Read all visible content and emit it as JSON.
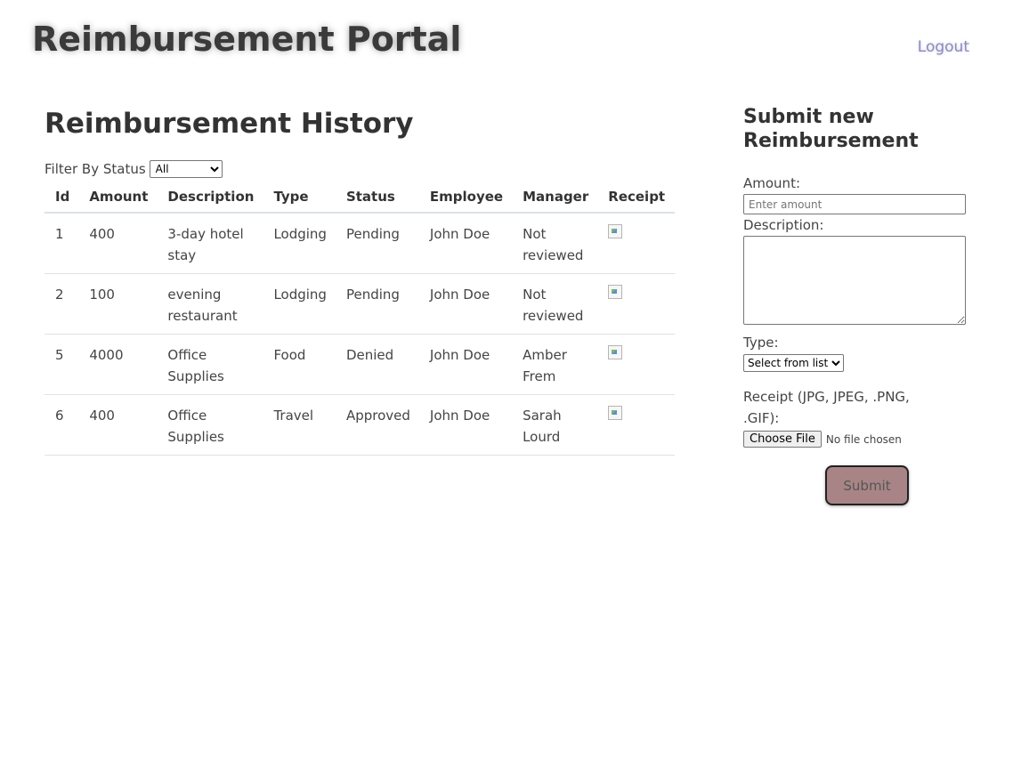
{
  "header": {
    "title": "Reimbursement Portal",
    "logout_label": "Logout"
  },
  "history": {
    "title": "Reimbursement History",
    "filter_label": "Filter By Status",
    "filter_selected": "All",
    "columns": [
      "Id",
      "Amount",
      "Description",
      "Type",
      "Status",
      "Employee",
      "Manager",
      "Receipt"
    ],
    "rows": [
      {
        "id": "1",
        "amount": "400",
        "description": "3-day hotel stay",
        "type": "Lodging",
        "status": "Pending",
        "employee": "John Doe",
        "manager": "Not reviewed"
      },
      {
        "id": "2",
        "amount": "100",
        "description": "evening restaurant",
        "type": "Lodging",
        "status": "Pending",
        "employee": "John Doe",
        "manager": "Not reviewed"
      },
      {
        "id": "5",
        "amount": "4000",
        "description": "Office Supplies",
        "type": "Food",
        "status": "Denied",
        "employee": "John Doe",
        "manager": "Amber Frem"
      },
      {
        "id": "6",
        "amount": "400",
        "description": "Office Supplies",
        "type": "Travel",
        "status": "Approved",
        "employee": "John Doe",
        "manager": "Sarah Lourd"
      }
    ]
  },
  "form": {
    "title": "Submit new Reimbursement",
    "amount_label": "Amount:",
    "amount_placeholder": "Enter amount",
    "description_label": "Description:",
    "type_label": "Type:",
    "type_selected": "Select from list",
    "receipt_label": "Receipt (JPG, JPEG, .PNG, .GIF):",
    "choose_file_label": "Choose File",
    "no_file_text": "No file chosen",
    "submit_label": "Submit"
  },
  "colors": {
    "submit_button": "#a98486",
    "logout_link": "#8a8ac8"
  }
}
